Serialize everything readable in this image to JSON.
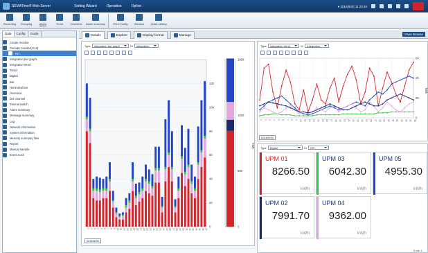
{
  "app": {
    "title": "SEMATime® Web Server",
    "menu": [
      "Setting Wizard",
      "Operation",
      "Option"
    ],
    "clock": "● 2016/9/30 11:23:46"
  },
  "ribbon": {
    "buttons": [
      {
        "label": "Recording",
        "icon": "recording-icon"
      },
      {
        "label": "Grouping",
        "icon": "grouping-icon"
      },
      {
        "label": "Alarm",
        "icon": "alarm-icon"
      },
      {
        "label": "Trend",
        "icon": "trend-icon"
      },
      {
        "label": "Overview",
        "icon": "overview-icon"
      },
      {
        "label": "Alarm summary",
        "icon": "alarm-summary-icon"
      },
      {
        "label": "Print Config",
        "icon": "print-icon"
      },
      {
        "label": "Window",
        "icon": "window-icon"
      },
      {
        "label": "Quick setting",
        "icon": "quick-setting-icon"
      }
    ]
  },
  "sidebar": {
    "tabs": [
      "Data",
      "Config",
      "Guide"
    ],
    "items": [
      "Create monitor",
      "Periodic monitor(1/13)",
      "IU1",
      "Integration bar graph",
      "Integration trend",
      "Trend",
      "Digital",
      "Bar",
      "Horizontal bar",
      "Overview",
      "DO channel",
      "Internal switch",
      "Alarm summary",
      "Message summary",
      "Log",
      "Network information",
      "System information",
      "Memory summary files",
      "Report",
      "Manual sample",
      "Event Lock"
    ],
    "selected_index": 2
  },
  "main": {
    "tabs": [
      "Details",
      "Explore",
      "Display format",
      "Manage"
    ],
    "selected_tab": 0,
    "pane_button": "Pane Browse"
  },
  "left_chart": {
    "type_label": "Type",
    "type_value": "Integration bar graph",
    "sub_label": "Di",
    "sub_value": "Integration",
    "date": "2016/9/30"
  },
  "trend_chart": {
    "type_label": "Type",
    "type_value": "Integration trend",
    "sub_label": "Gr",
    "sub_value": "Integration",
    "date": "2016/9/30"
  },
  "digital": {
    "type_label": "Type",
    "type_value": "Digital",
    "sub_label": "Gr",
    "sub_value": "GR",
    "tiles": [
      {
        "name": "UPM 01",
        "value": "8266.50",
        "unit": "kWh",
        "color": "#d6242b"
      },
      {
        "name": "UPM 03",
        "value": "6042.30",
        "unit": "kWh",
        "color": "#36c63c"
      },
      {
        "name": "UPM 05",
        "value": "4955.30",
        "unit": "kWh",
        "color": "#2346c8"
      },
      {
        "name": "UPM 02",
        "value": "7991.70",
        "unit": "kWh",
        "color": "#1a2a6c"
      },
      {
        "name": "UPM 04",
        "value": "9362.00",
        "unit": "kWh",
        "color": "#e3a6df"
      }
    ]
  },
  "status": {
    "zoom": "5 min",
    "page": "1"
  },
  "chart_data": [
    {
      "type": "bar",
      "stacked": true,
      "ylim": [
        0,
        140
      ],
      "yticks": [
        0,
        20,
        40,
        60,
        80,
        100,
        120
      ],
      "categories": [
        "1",
        "2",
        "3",
        "4",
        "5",
        "6",
        "7",
        "8",
        "9",
        "10",
        "11",
        "12",
        "13",
        "14",
        "15",
        "16",
        "17",
        "18",
        "19",
        "20",
        "21",
        "22",
        "23",
        "24",
        "25",
        "26",
        "27",
        "28",
        "29",
        "30",
        "31",
        "32",
        "33",
        "34",
        "35",
        "36",
        "37"
      ],
      "series": [
        {
          "color": "#d6242b",
          "values": [
            80,
            70,
            24,
            22,
            22,
            24,
            24,
            30,
            16,
            8,
            6,
            6,
            12,
            15,
            30,
            18,
            21,
            24,
            30,
            28,
            26,
            37,
            37,
            12,
            38,
            50,
            38,
            12,
            24,
            45,
            34,
            40,
            28,
            24,
            40,
            50,
            58
          ]
        },
        {
          "color": "#e3a6df",
          "values": [
            10,
            10,
            6,
            8,
            7,
            6,
            6,
            8,
            5,
            3,
            2,
            3,
            4,
            5,
            8,
            6,
            6,
            6,
            8,
            8,
            6,
            10,
            10,
            4,
            10,
            10,
            10,
            4,
            6,
            12,
            10,
            10,
            8,
            6,
            12,
            12,
            16
          ]
        },
        {
          "color": "#36c63c",
          "values": [
            2,
            2,
            2,
            2,
            2,
            2,
            2,
            2,
            1,
            1,
            1,
            1,
            2,
            2,
            2,
            2,
            2,
            2,
            2,
            2,
            2,
            2,
            2,
            1,
            2,
            2,
            2,
            1,
            2,
            2,
            2,
            2,
            2,
            2,
            2,
            2,
            2
          ]
        },
        {
          "color": "#2346c8",
          "values": [
            28,
            26,
            8,
            10,
            10,
            8,
            10,
            14,
            8,
            4,
            2,
            2,
            6,
            6,
            14,
            10,
            8,
            10,
            12,
            10,
            10,
            18,
            18,
            8,
            40,
            44,
            30,
            6,
            10,
            26,
            20,
            30,
            14,
            10,
            30,
            42,
            46
          ]
        }
      ]
    },
    {
      "type": "bar",
      "stacked": true,
      "ylim": [
        0,
        1500
      ],
      "yticks": [
        0,
        500,
        1000,
        1500
      ],
      "ylabel": "kWh",
      "categories": [
        "Total"
      ],
      "series": [
        {
          "color": "#d6242b",
          "values": [
            860
          ]
        },
        {
          "color": "#1a2a6c",
          "values": [
            100
          ]
        },
        {
          "color": "#e3a6df",
          "values": [
            160
          ]
        },
        {
          "color": "#2346c8",
          "values": [
            390
          ]
        }
      ]
    },
    {
      "type": "line",
      "ylim": [
        0,
        60
      ],
      "yticks": [
        0,
        20,
        40,
        60
      ],
      "ylabel": "kWh",
      "x": [
        "1",
        "2",
        "3",
        "4",
        "5",
        "6",
        "7",
        "8",
        "9",
        "10",
        "11",
        "12",
        "13",
        "14",
        "15",
        "16",
        "17",
        "18",
        "19",
        "20",
        "21",
        "22",
        "23",
        "24",
        "25",
        "26",
        "27",
        "28",
        "29",
        "30",
        "31",
        "32",
        "33",
        "34",
        "35",
        "36"
      ],
      "series": [
        {
          "color": "#d6242b",
          "values": [
            18,
            50,
            54,
            26,
            10,
            32,
            48,
            36,
            14,
            8,
            28,
            6,
            18,
            34,
            18,
            14,
            30,
            40,
            16,
            32,
            44,
            52,
            38,
            14,
            26,
            50,
            42,
            12,
            30,
            46,
            36,
            24,
            16,
            32,
            48,
            56
          ]
        },
        {
          "color": "#2346c8",
          "values": [
            8,
            12,
            16,
            18,
            20,
            22,
            18,
            14,
            10,
            6,
            4,
            3,
            4,
            6,
            8,
            10,
            12,
            10,
            8,
            10,
            12,
            14,
            16,
            14,
            12,
            18,
            22,
            26,
            24,
            28,
            34,
            36,
            38,
            40,
            42,
            40
          ]
        },
        {
          "color": "#36c63c",
          "values": [
            2,
            3,
            3,
            4,
            4,
            3,
            3,
            3,
            2,
            2,
            2,
            2,
            2,
            3,
            3,
            3,
            3,
            3,
            3,
            4,
            4,
            4,
            4,
            4,
            4,
            4,
            4,
            5,
            5,
            5,
            6,
            6,
            6,
            6,
            6,
            6
          ]
        },
        {
          "color": "#e3a6df",
          "values": [
            6,
            10,
            8,
            6,
            4,
            6,
            10,
            12,
            8,
            4,
            6,
            4,
            6,
            10,
            8,
            6,
            10,
            12,
            6,
            10,
            12,
            14,
            10,
            6,
            8,
            16,
            12,
            6,
            10,
            16,
            12,
            8,
            6,
            10,
            14,
            16
          ]
        },
        {
          "color": "#1a2a6c",
          "values": [
            12,
            14,
            16,
            15,
            14,
            13,
            12,
            10,
            8,
            6,
            6,
            5,
            6,
            8,
            10,
            12,
            14,
            12,
            10,
            8,
            8,
            10,
            12,
            14,
            16,
            14,
            12,
            12,
            14,
            18,
            20,
            22,
            24,
            22,
            20,
            18
          ]
        }
      ]
    }
  ]
}
